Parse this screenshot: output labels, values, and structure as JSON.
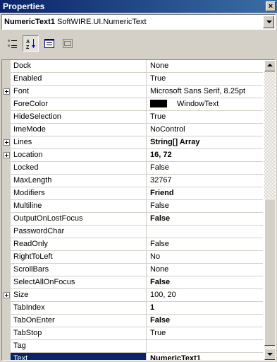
{
  "window": {
    "title": "Properties",
    "close_glyph": "×"
  },
  "object_selector": {
    "name": "NumericText1",
    "type": "SoftWIRE.UI.NumericText"
  },
  "toolbar": {
    "buttons": [
      {
        "icon": "categorized-icon",
        "pressed": false
      },
      {
        "icon": "alphabetical-sort-icon",
        "pressed": true
      },
      {
        "icon": "properties-icon",
        "pressed": false
      },
      {
        "icon": "property-pages-icon",
        "pressed": false,
        "disabled": true
      }
    ]
  },
  "properties": [
    {
      "name": "Dock",
      "value": "None"
    },
    {
      "name": "Enabled",
      "value": "True"
    },
    {
      "name": "Font",
      "value": "Microsoft Sans Serif, 8.25pt",
      "expandable": true
    },
    {
      "name": "ForeColor",
      "value": "WindowText",
      "swatch": "#000000"
    },
    {
      "name": "HideSelection",
      "value": "True"
    },
    {
      "name": "ImeMode",
      "value": "NoControl"
    },
    {
      "name": "Lines",
      "value": "String[] Array",
      "expandable": true,
      "bold": true
    },
    {
      "name": "Location",
      "value": "16, 72",
      "expandable": true,
      "bold": true
    },
    {
      "name": "Locked",
      "value": "False"
    },
    {
      "name": "MaxLength",
      "value": "32767"
    },
    {
      "name": "Modifiers",
      "value": "Friend",
      "bold": true
    },
    {
      "name": "Multiline",
      "value": "False"
    },
    {
      "name": "OutputOnLostFocus",
      "value": "False",
      "bold": true
    },
    {
      "name": "PasswordChar",
      "value": ""
    },
    {
      "name": "ReadOnly",
      "value": "False"
    },
    {
      "name": "RightToLeft",
      "value": "No"
    },
    {
      "name": "ScrollBars",
      "value": "None"
    },
    {
      "name": "SelectAllOnFocus",
      "value": "False",
      "bold": true
    },
    {
      "name": "Size",
      "value": "100, 20",
      "expandable": true
    },
    {
      "name": "TabIndex",
      "value": "1",
      "bold": true
    },
    {
      "name": "TabOnEnter",
      "value": "False",
      "bold": true
    },
    {
      "name": "TabStop",
      "value": "True"
    },
    {
      "name": "Tag",
      "value": ""
    },
    {
      "name": "Text",
      "value": "NumericText1",
      "bold": true,
      "selected": true
    }
  ],
  "colors": {
    "selection": "#0a246a",
    "face": "#d4d0c8"
  }
}
